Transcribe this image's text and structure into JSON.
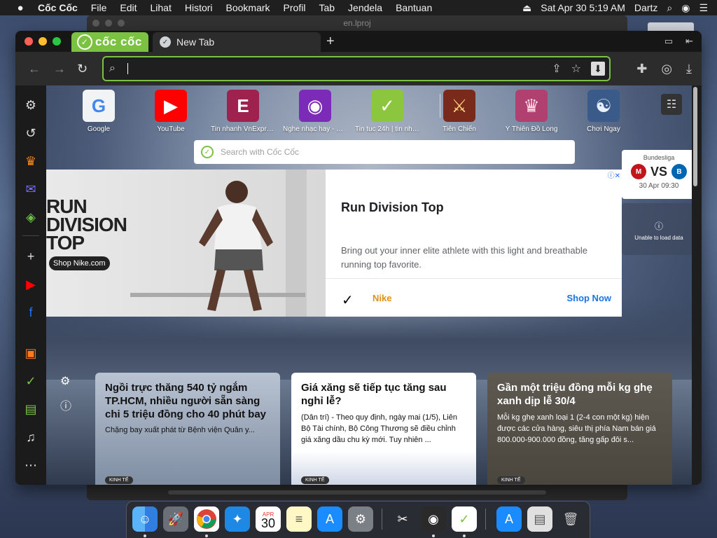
{
  "menubar": {
    "apple": "",
    "app": "Cốc Cốc",
    "items": [
      "File",
      "Edit",
      "Lihat",
      "Histori",
      "Bookmark",
      "Profil",
      "Tab",
      "Jendela",
      "Bantuan"
    ],
    "datetime": "Sat Apr 30  5:19 AM",
    "user": "Dartz"
  },
  "background_window": {
    "title": "en.lproj"
  },
  "browser": {
    "brand": "cốc cốc",
    "tab": {
      "title": "New Tab",
      "icon": "coccoc-tab-icon"
    },
    "url": {
      "value": "",
      "placeholder": ""
    },
    "accent": "#7cc242"
  },
  "speed_dial": [
    {
      "label": "Google",
      "letter": "G",
      "bg": "#f1f3f4",
      "color": "#4285f4"
    },
    {
      "label": "YouTube",
      "letter": "▶",
      "bg": "#ff0000",
      "color": "#ffffff"
    },
    {
      "label": "Tin nhanh VnExpre...",
      "letter": "E",
      "bg": "#9f224e",
      "color": "#ffffff"
    },
    {
      "label": "Nghe nhạc hay - Tả...",
      "letter": "◉",
      "bg": "#7b2bb8",
      "color": "#ffffff"
    },
    {
      "label": "Tin tuc 24h | tin nha...",
      "letter": "✓",
      "bg": "#8cc63f",
      "color": "#ffffff"
    },
    {
      "label": "Tiên Chiến",
      "letter": "⚔",
      "bg": "#7a2a1a",
      "color": "#ffd27a"
    },
    {
      "label": "Ỷ Thiên Đồ Long",
      "letter": "♛",
      "bg": "#b04070",
      "color": "#ffe0ea"
    },
    {
      "label": "Chơi Ngay",
      "letter": "☯",
      "bg": "#3a5a8a",
      "color": "#e8f0ff"
    }
  ],
  "search": {
    "placeholder": "Search with Cốc Cốc"
  },
  "ad": {
    "image_text": "RUN\nDIVISION\nTOP",
    "image_pill": "Shop Nike.com",
    "title": "Run Division Top",
    "description": "Bring out your inner elite athlete with this light and breathable running top favorite.",
    "brand": "Nike",
    "cta": "Shop Now"
  },
  "widget": {
    "league": "Bundesliga",
    "vs": "VS",
    "time": "30 Apr 09:30",
    "unable": "Unable to load data"
  },
  "news": [
    {
      "title": "Ngồi trực thăng 540 tỷ ngắm TP.HCM, nhiều người sẵn sàng chi 5 triệu đồng cho 40 phút bay",
      "desc": "Chặng bay xuất phát từ Bệnh viện Quân y...",
      "category": "KINH TẾ"
    },
    {
      "title": "Giá xăng sẽ tiếp tục tăng sau nghỉ lễ?",
      "desc": "(Dân trí) - Theo quy định, ngày mai (1/5), Liên Bộ Tài chính, Bộ Công Thương sẽ điều chỉnh giá xăng dầu chu kỳ mới. Tuy nhiên ...",
      "category": "KINH TẾ"
    },
    {
      "title": "Gần một triệu đồng mỗi kg ghẹ xanh dịp lễ 30/4",
      "desc": "Mỗi kg ghẹ xanh loại 1 (2-4 con một kg) hiện được các cửa hàng, siêu thị phía Nam bán giá 800.000-900.000 đồng, tăng gấp đôi s...",
      "category": "KINH TẾ"
    }
  ],
  "dock": {
    "calendar_month": "APR",
    "calendar_day": "30"
  }
}
